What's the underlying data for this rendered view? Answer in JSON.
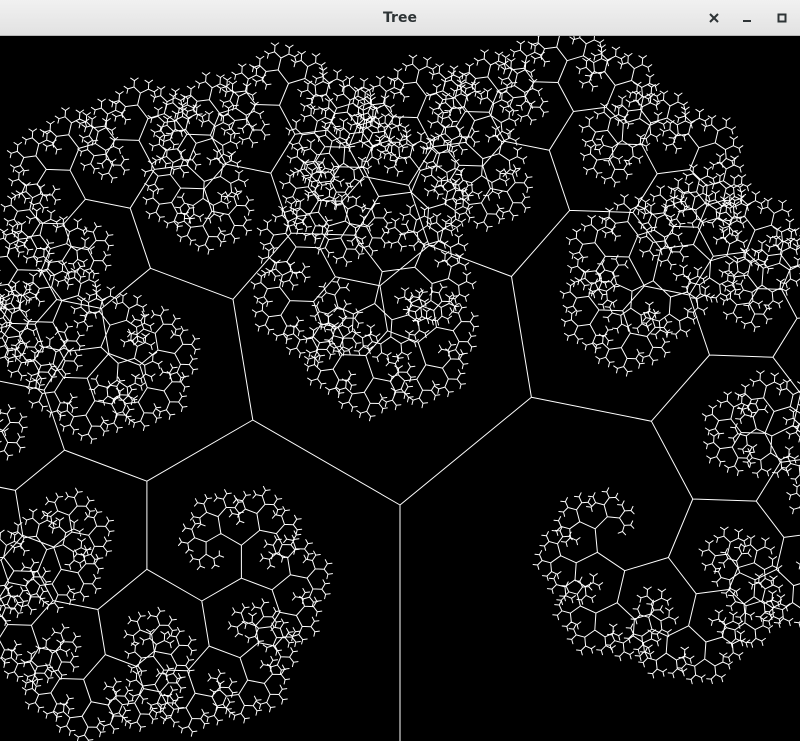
{
  "window": {
    "title": "Tree"
  },
  "titlebar_buttons": {
    "close_icon": "close-icon",
    "minimize_icon": "minimize-icon",
    "maximize_icon": "maximize-icon"
  },
  "colors": {
    "titlebar_bg": "#e8e8e8",
    "title_text": "#2e3436",
    "canvas_bg": "#000000",
    "branch_stroke": "#ffffff"
  },
  "fractal": {
    "kind": "recursive binary tree",
    "depth": 13,
    "length_ratio": 0.72,
    "branch_angles_deg": [
      -60,
      22
    ]
  }
}
